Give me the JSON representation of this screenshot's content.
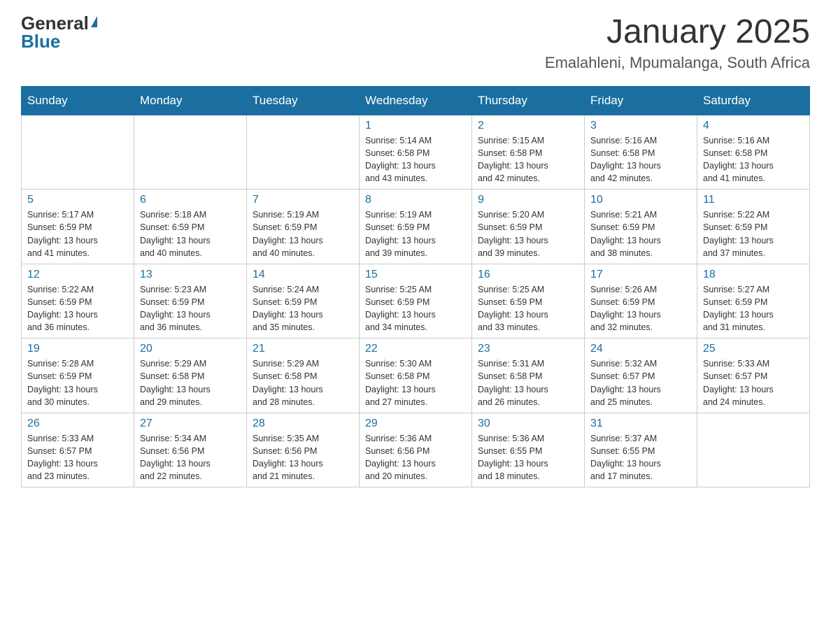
{
  "header": {
    "logo_general": "General",
    "logo_blue": "Blue",
    "month_title": "January 2025",
    "location": "Emalahleni, Mpumalanga, South Africa"
  },
  "weekdays": [
    "Sunday",
    "Monday",
    "Tuesday",
    "Wednesday",
    "Thursday",
    "Friday",
    "Saturday"
  ],
  "weeks": [
    [
      {
        "day": "",
        "info": ""
      },
      {
        "day": "",
        "info": ""
      },
      {
        "day": "",
        "info": ""
      },
      {
        "day": "1",
        "info": "Sunrise: 5:14 AM\nSunset: 6:58 PM\nDaylight: 13 hours\nand 43 minutes."
      },
      {
        "day": "2",
        "info": "Sunrise: 5:15 AM\nSunset: 6:58 PM\nDaylight: 13 hours\nand 42 minutes."
      },
      {
        "day": "3",
        "info": "Sunrise: 5:16 AM\nSunset: 6:58 PM\nDaylight: 13 hours\nand 42 minutes."
      },
      {
        "day": "4",
        "info": "Sunrise: 5:16 AM\nSunset: 6:58 PM\nDaylight: 13 hours\nand 41 minutes."
      }
    ],
    [
      {
        "day": "5",
        "info": "Sunrise: 5:17 AM\nSunset: 6:59 PM\nDaylight: 13 hours\nand 41 minutes."
      },
      {
        "day": "6",
        "info": "Sunrise: 5:18 AM\nSunset: 6:59 PM\nDaylight: 13 hours\nand 40 minutes."
      },
      {
        "day": "7",
        "info": "Sunrise: 5:19 AM\nSunset: 6:59 PM\nDaylight: 13 hours\nand 40 minutes."
      },
      {
        "day": "8",
        "info": "Sunrise: 5:19 AM\nSunset: 6:59 PM\nDaylight: 13 hours\nand 39 minutes."
      },
      {
        "day": "9",
        "info": "Sunrise: 5:20 AM\nSunset: 6:59 PM\nDaylight: 13 hours\nand 39 minutes."
      },
      {
        "day": "10",
        "info": "Sunrise: 5:21 AM\nSunset: 6:59 PM\nDaylight: 13 hours\nand 38 minutes."
      },
      {
        "day": "11",
        "info": "Sunrise: 5:22 AM\nSunset: 6:59 PM\nDaylight: 13 hours\nand 37 minutes."
      }
    ],
    [
      {
        "day": "12",
        "info": "Sunrise: 5:22 AM\nSunset: 6:59 PM\nDaylight: 13 hours\nand 36 minutes."
      },
      {
        "day": "13",
        "info": "Sunrise: 5:23 AM\nSunset: 6:59 PM\nDaylight: 13 hours\nand 36 minutes."
      },
      {
        "day": "14",
        "info": "Sunrise: 5:24 AM\nSunset: 6:59 PM\nDaylight: 13 hours\nand 35 minutes."
      },
      {
        "day": "15",
        "info": "Sunrise: 5:25 AM\nSunset: 6:59 PM\nDaylight: 13 hours\nand 34 minutes."
      },
      {
        "day": "16",
        "info": "Sunrise: 5:25 AM\nSunset: 6:59 PM\nDaylight: 13 hours\nand 33 minutes."
      },
      {
        "day": "17",
        "info": "Sunrise: 5:26 AM\nSunset: 6:59 PM\nDaylight: 13 hours\nand 32 minutes."
      },
      {
        "day": "18",
        "info": "Sunrise: 5:27 AM\nSunset: 6:59 PM\nDaylight: 13 hours\nand 31 minutes."
      }
    ],
    [
      {
        "day": "19",
        "info": "Sunrise: 5:28 AM\nSunset: 6:59 PM\nDaylight: 13 hours\nand 30 minutes."
      },
      {
        "day": "20",
        "info": "Sunrise: 5:29 AM\nSunset: 6:58 PM\nDaylight: 13 hours\nand 29 minutes."
      },
      {
        "day": "21",
        "info": "Sunrise: 5:29 AM\nSunset: 6:58 PM\nDaylight: 13 hours\nand 28 minutes."
      },
      {
        "day": "22",
        "info": "Sunrise: 5:30 AM\nSunset: 6:58 PM\nDaylight: 13 hours\nand 27 minutes."
      },
      {
        "day": "23",
        "info": "Sunrise: 5:31 AM\nSunset: 6:58 PM\nDaylight: 13 hours\nand 26 minutes."
      },
      {
        "day": "24",
        "info": "Sunrise: 5:32 AM\nSunset: 6:57 PM\nDaylight: 13 hours\nand 25 minutes."
      },
      {
        "day": "25",
        "info": "Sunrise: 5:33 AM\nSunset: 6:57 PM\nDaylight: 13 hours\nand 24 minutes."
      }
    ],
    [
      {
        "day": "26",
        "info": "Sunrise: 5:33 AM\nSunset: 6:57 PM\nDaylight: 13 hours\nand 23 minutes."
      },
      {
        "day": "27",
        "info": "Sunrise: 5:34 AM\nSunset: 6:56 PM\nDaylight: 13 hours\nand 22 minutes."
      },
      {
        "day": "28",
        "info": "Sunrise: 5:35 AM\nSunset: 6:56 PM\nDaylight: 13 hours\nand 21 minutes."
      },
      {
        "day": "29",
        "info": "Sunrise: 5:36 AM\nSunset: 6:56 PM\nDaylight: 13 hours\nand 20 minutes."
      },
      {
        "day": "30",
        "info": "Sunrise: 5:36 AM\nSunset: 6:55 PM\nDaylight: 13 hours\nand 18 minutes."
      },
      {
        "day": "31",
        "info": "Sunrise: 5:37 AM\nSunset: 6:55 PM\nDaylight: 13 hours\nand 17 minutes."
      },
      {
        "day": "",
        "info": ""
      }
    ]
  ]
}
